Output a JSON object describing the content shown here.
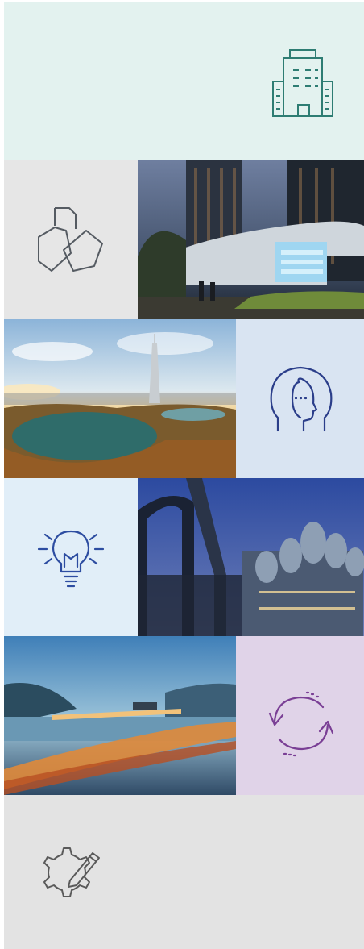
{
  "tiles": [
    {
      "row": 1,
      "kind": "icon",
      "icon": "office-building-icon",
      "background": "#e3f2ef",
      "stroke": "#2e7d73"
    },
    {
      "row": 2,
      "kind": "icon",
      "icon": "documents-icon",
      "background": "#e6e6e6",
      "stroke": "#555b62"
    },
    {
      "row": 2,
      "kind": "photo",
      "subject": "residential-complex-entrance-at-dusk"
    },
    {
      "row": 3,
      "kind": "photo",
      "subject": "city-skyline-with-tower-and-lake"
    },
    {
      "row": 3,
      "kind": "icon",
      "icon": "human-head-profile-icon",
      "background": "#d9e4f2",
      "stroke": "#2b3e8a"
    },
    {
      "row": 4,
      "kind": "icon",
      "icon": "lightbulb-icon",
      "background": "#e1eef8",
      "stroke": "#2d4da1"
    },
    {
      "row": 4,
      "kind": "photo",
      "subject": "industrial-plant-with-pipes-at-night"
    },
    {
      "row": 5,
      "kind": "photo",
      "subject": "highway-bridge-at-dusk"
    },
    {
      "row": 5,
      "kind": "icon",
      "icon": "refresh-cycle-icon",
      "background": "#e0d3e8",
      "stroke": "#7a3f95"
    },
    {
      "row": 6,
      "kind": "icon",
      "icon": "gear-with-pencil-icon",
      "background": "#e3e3e3",
      "stroke": "#5a5a5a"
    }
  ]
}
